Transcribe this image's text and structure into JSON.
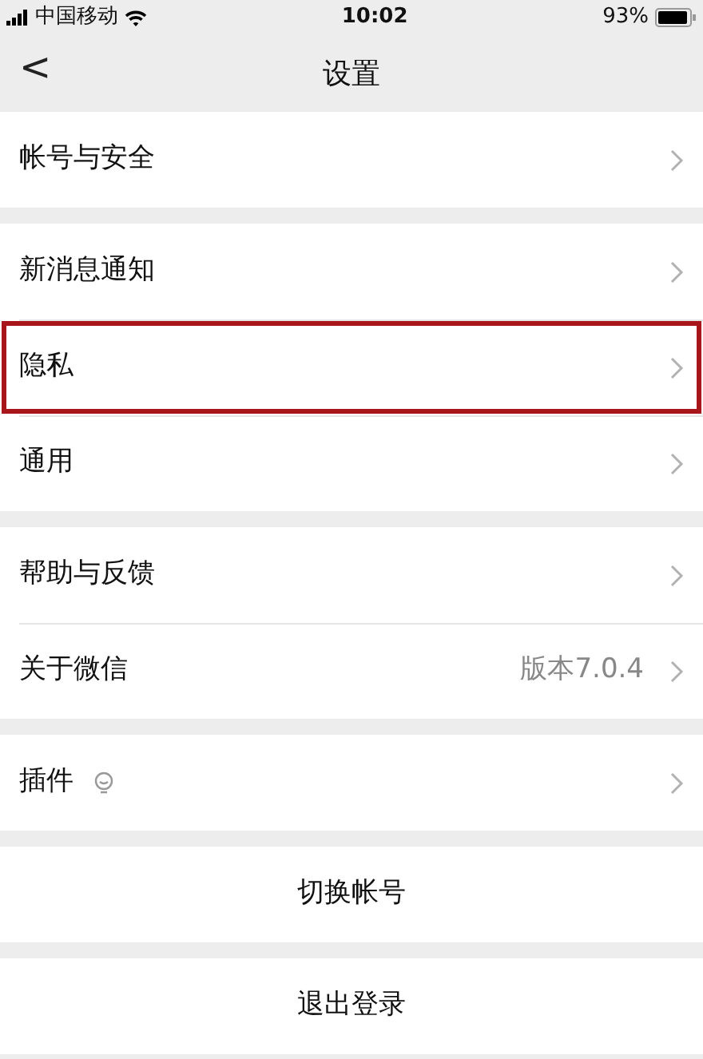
{
  "status_bar": {
    "carrier": "中国移动",
    "time": "10:02",
    "battery": "93%"
  },
  "nav_bar": {
    "back": "<",
    "title": "设置"
  },
  "sections": [
    {
      "rows": [
        {
          "kind": "nav",
          "label": "帐号与安全",
          "highlighted": false
        }
      ]
    },
    {
      "rows": [
        {
          "kind": "nav",
          "label": "新消息通知",
          "highlighted": false
        },
        {
          "kind": "nav",
          "label": "隐私",
          "highlighted": true
        },
        {
          "kind": "nav",
          "label": "通用",
          "highlighted": false
        }
      ]
    },
    {
      "rows": [
        {
          "kind": "nav",
          "label": "帮助与反馈",
          "highlighted": false
        },
        {
          "kind": "nav",
          "label": "关于微信",
          "value": "版本7.0.4",
          "highlighted": false
        }
      ]
    },
    {
      "rows": [
        {
          "kind": "nav",
          "label": "插件",
          "bulb": true,
          "highlighted": false
        }
      ]
    },
    {
      "rows": [
        {
          "kind": "action",
          "label": "切换帐号",
          "highlighted": false
        }
      ]
    },
    {
      "rows": [
        {
          "kind": "action",
          "label": "退出登录",
          "highlighted": false
        }
      ]
    }
  ]
}
